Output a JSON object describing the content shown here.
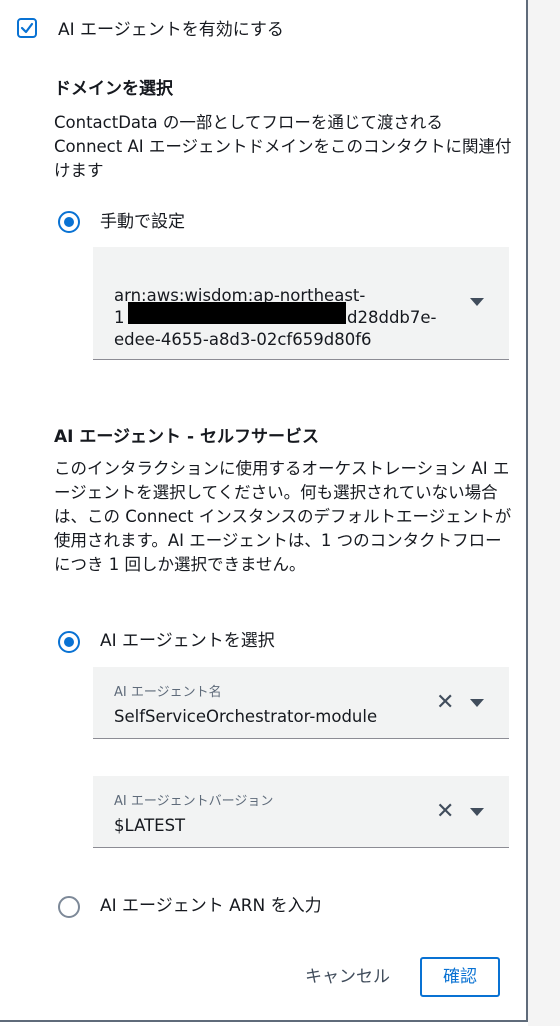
{
  "enable_checkbox": {
    "label": "AI エージェントを有効にする",
    "checked": true
  },
  "domain_section": {
    "title": "ドメインを選択",
    "description": "ContactData の一部としてフローを通じて渡される Connect AI エージェントドメインをこのコンタクトに関連付けます",
    "radio_label": "手動で設定",
    "domain_value_line1": "arn:aws:wisdom:ap-northeast-",
    "domain_value_line2_prefix": "1",
    "domain_value_line2_suffix": "d28ddb7e-",
    "domain_value_line3": "edee-4655-a8d3-02cf659d80f6"
  },
  "agent_section": {
    "title": "AI エージェント - セルフサービス",
    "description": "このインタラクションに使用するオーケストレーション AI エージェントを選択してください。何も選択されていない場合は、この Connect インスタンスのデフォルトエージェントが使用されます。AI エージェントは、1 つのコンタクトフローにつき 1 回しか選択できません。",
    "select_radio_label": "AI エージェントを選択",
    "agent_name_label": "AI エージェント名",
    "agent_name_value": "SelfServiceOrchestrator-module",
    "agent_version_label": "AI エージェントバージョン",
    "agent_version_value": "$LATEST",
    "arn_radio_label": "AI エージェント ARN を入力"
  },
  "footer": {
    "cancel_label": "キャンセル",
    "confirm_label": "確認"
  },
  "colors": {
    "accent": "#0972d3",
    "text": "#16191f",
    "field_bg": "#f2f3f3"
  }
}
